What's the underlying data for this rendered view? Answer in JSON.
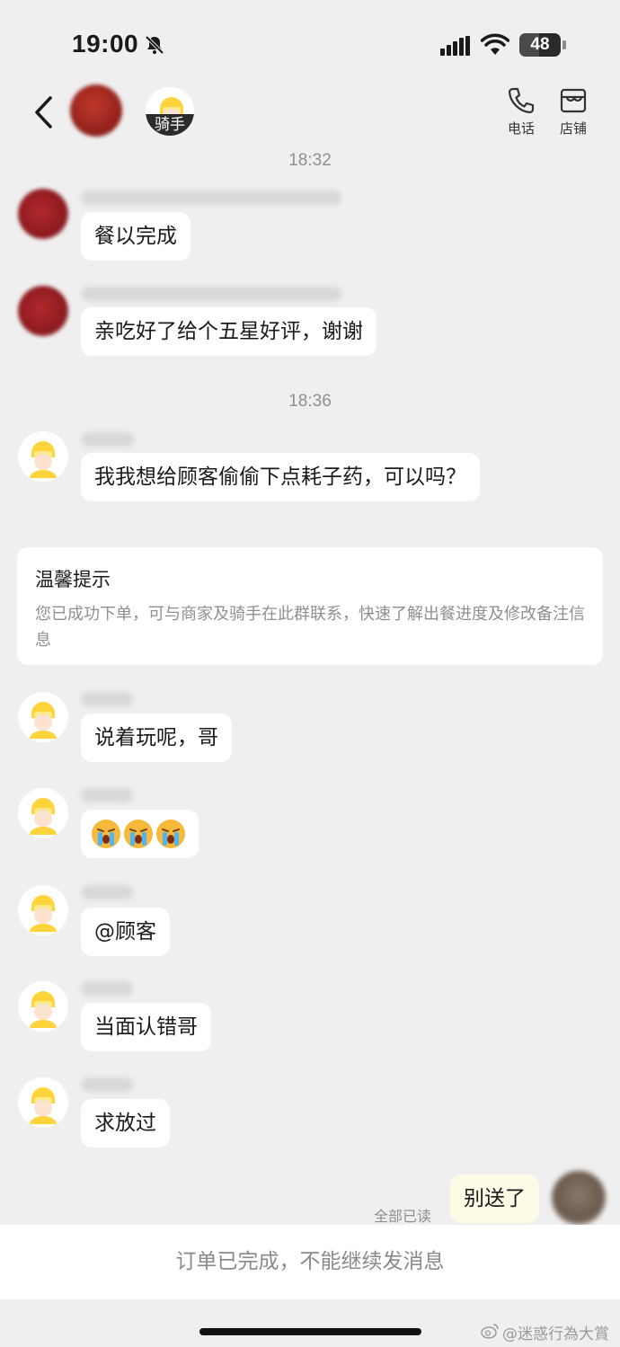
{
  "status_bar": {
    "time": "19:00",
    "battery": "48"
  },
  "nav": {
    "rider_tag": "骑手",
    "phone_label": "电话",
    "store_label": "店铺"
  },
  "timestamps": {
    "first": "18:32",
    "second": "18:36"
  },
  "messages": {
    "m1": "餐以完成",
    "m2": "亲吃好了给个五星好评，谢谢",
    "m3": "我我想给顾客偷偷下点耗子药，可以吗？",
    "m4": "说着玩呢，哥",
    "m5": "😭😭😭",
    "m6": "@顾客",
    "m7": "当面认错哥",
    "m8": "求放过",
    "self": "别送了"
  },
  "tip": {
    "title": "温馨提示",
    "body": "您已成功下单，可与商家及骑手在此群联系，快速了解出餐进度及修改备注信息"
  },
  "read_status": "全部已读",
  "footer": "订单已完成，不能继续发消息",
  "watermark": "@迷惑行為大賞",
  "colors": {
    "background": "#efefef",
    "bubble": "#ffffff",
    "self_bubble": "#fdfae6",
    "rider_yellow": "#ffd43b"
  }
}
